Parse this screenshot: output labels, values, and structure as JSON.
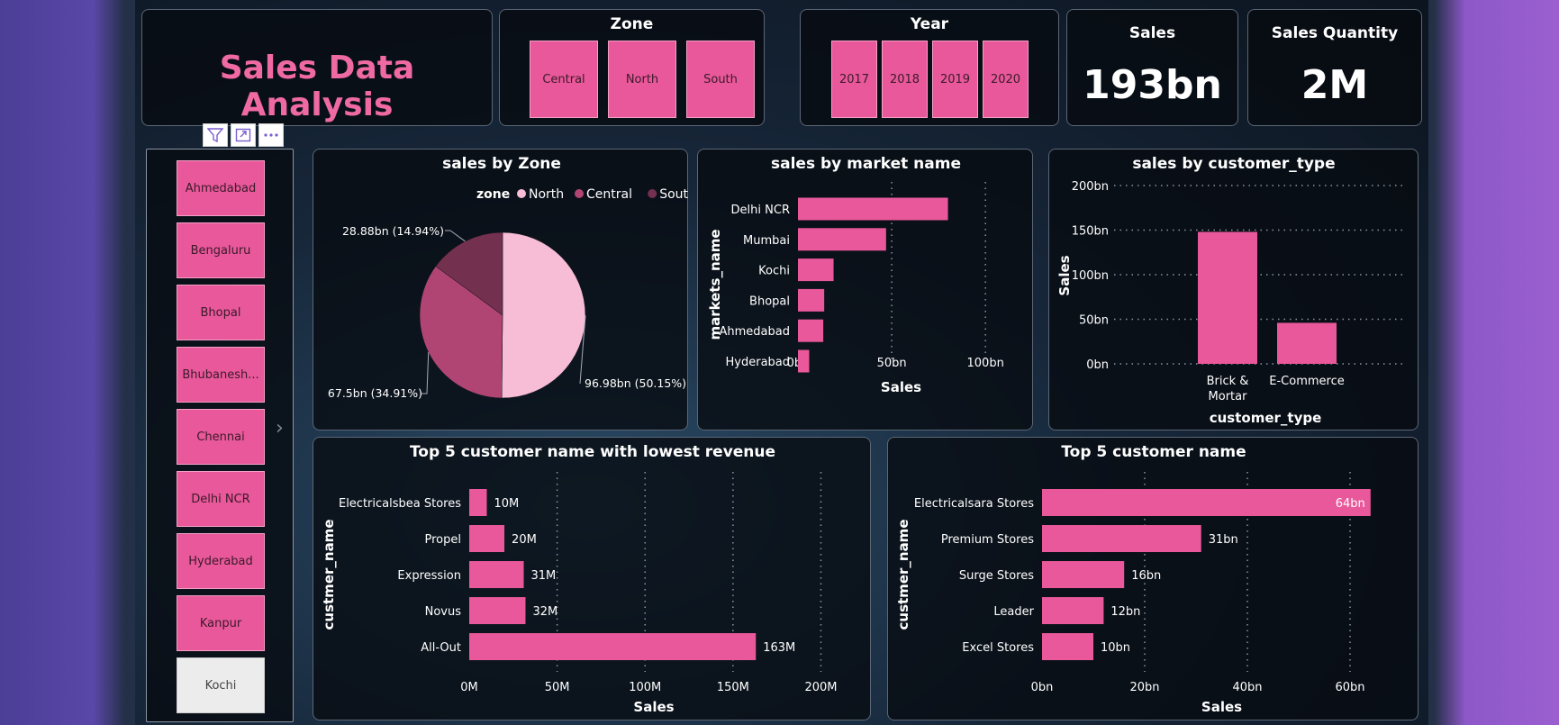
{
  "title": "Sales Data Analysis",
  "zone_slicer": {
    "title": "Zone",
    "options": [
      "Central",
      "North",
      "South"
    ]
  },
  "year_slicer": {
    "title": "Year",
    "options": [
      "2017",
      "2018",
      "2019",
      "2020"
    ]
  },
  "kpi_sales": {
    "title": "Sales",
    "value": "193bn"
  },
  "kpi_quantity": {
    "title": "Sales Quantity",
    "value": "2M"
  },
  "city_slicer": {
    "items": [
      {
        "label": "Ahmedabad",
        "selected": true
      },
      {
        "label": "Bengaluru",
        "selected": true
      },
      {
        "label": "Bhopal",
        "selected": true
      },
      {
        "label": "Bhubanesh...",
        "selected": true
      },
      {
        "label": "Chennai",
        "selected": true
      },
      {
        "label": "Delhi NCR",
        "selected": true
      },
      {
        "label": "Hyderabad",
        "selected": true
      },
      {
        "label": "Kanpur",
        "selected": true
      },
      {
        "label": "Kochi",
        "selected": false
      }
    ],
    "next_arrow": "›"
  },
  "colors": {
    "accent": "#e8589a",
    "north": "#f7bcd6",
    "central": "#b04574",
    "south": "#74304f",
    "title_pink": "#ef6aa2"
  },
  "chart_data": [
    {
      "id": "pie_zone",
      "type": "pie",
      "title": "sales by Zone",
      "legend_title": "zone",
      "legend": [
        "North",
        "Central",
        "South"
      ],
      "slices": [
        {
          "name": "North",
          "value": 96.98,
          "label": "96.98bn (50.15%)"
        },
        {
          "name": "Central",
          "value": 67.5,
          "label": "67.5bn (34.91%)"
        },
        {
          "name": "South",
          "value": 28.88,
          "label": "28.88bn (14.94%)"
        }
      ]
    },
    {
      "id": "bar_market",
      "type": "bar",
      "orientation": "horizontal",
      "title": "sales by market name",
      "xlabel": "Sales",
      "ylabel": "markets_name",
      "categories": [
        "Delhi NCR",
        "Mumbai",
        "Kochi",
        "Bhopal",
        "Ahmedabad",
        "Hyderabad"
      ],
      "values": [
        80,
        47,
        19,
        14,
        13.5,
        6
      ],
      "xlim": [
        0,
        110
      ],
      "ticks": [
        0,
        50,
        100
      ],
      "tick_labels": [
        "0bn",
        "50bn",
        "100bn"
      ]
    },
    {
      "id": "bar_customer_type",
      "type": "bar",
      "orientation": "vertical",
      "title": "sales by customer_type",
      "xlabel": "customer_type",
      "ylabel": "Sales",
      "categories": [
        "Brick & Mortar",
        "E-Commerce"
      ],
      "values": [
        148,
        46
      ],
      "ylim": [
        0,
        200
      ],
      "ticks": [
        0,
        50,
        100,
        150,
        200
      ],
      "tick_labels": [
        "0bn",
        "50bn",
        "100bn",
        "150bn",
        "200bn"
      ]
    },
    {
      "id": "bar_lowest",
      "type": "bar",
      "orientation": "horizontal",
      "title": "Top 5 customer name with lowest revenue",
      "xlabel": "Sales",
      "ylabel": "custmer_name",
      "categories": [
        "Electricalsbea Stores",
        "Propel",
        "Expression",
        "Novus",
        "All-Out"
      ],
      "values": [
        10,
        20,
        31,
        32,
        163
      ],
      "data_labels": [
        "10M",
        "20M",
        "31M",
        "32M",
        "163M"
      ],
      "xlim": [
        0,
        210
      ],
      "ticks": [
        0,
        50,
        100,
        150,
        200
      ],
      "tick_labels": [
        "0M",
        "50M",
        "100M",
        "150M",
        "200M"
      ]
    },
    {
      "id": "bar_top",
      "type": "bar",
      "orientation": "horizontal",
      "title": "Top 5 customer name",
      "xlabel": "Sales",
      "ylabel": "custmer_name",
      "categories": [
        "Electricalsara Stores",
        "Premium Stores",
        "Surge Stores",
        "Leader",
        "Excel Stores"
      ],
      "values": [
        64,
        31,
        16,
        12,
        10
      ],
      "data_labels": [
        "64bn",
        "31bn",
        "16bn",
        "12bn",
        "10bn"
      ],
      "xlim": [
        0,
        70
      ],
      "ticks": [
        0,
        20,
        40,
        60
      ],
      "tick_labels": [
        "0bn",
        "20bn",
        "40bn",
        "60bn"
      ]
    }
  ]
}
